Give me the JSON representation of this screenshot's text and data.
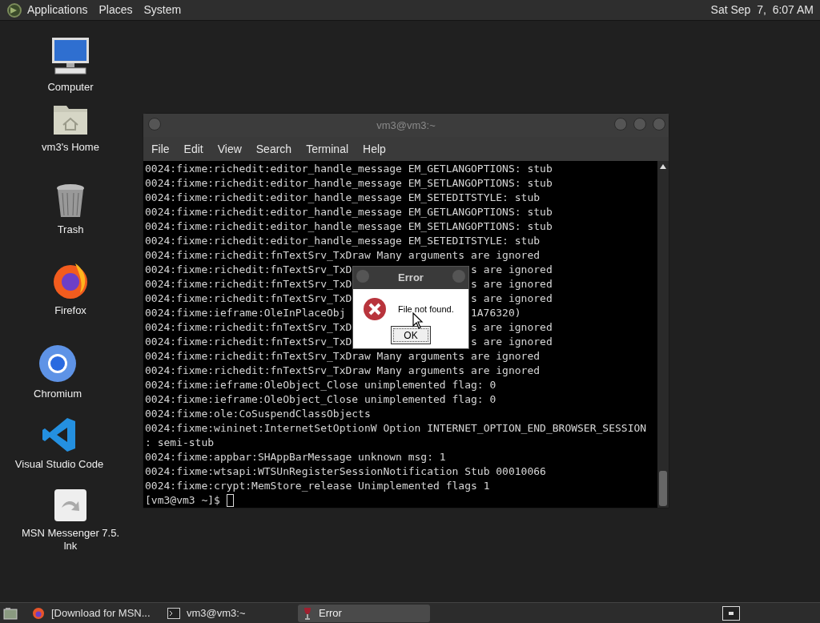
{
  "top_panel": {
    "menus": [
      "Applications",
      "Places",
      "System"
    ],
    "clock": "Sat Sep  7,  6:07 AM"
  },
  "desktop_icons": [
    {
      "kind": "computer",
      "label": "Computer"
    },
    {
      "kind": "home",
      "label": "vm3's Home"
    },
    {
      "kind": "trash",
      "label": "Trash"
    },
    {
      "kind": "firefox",
      "label": "Firefox"
    },
    {
      "kind": "chromium",
      "label": "Chromium"
    },
    {
      "kind": "vscode",
      "label": "Visual Studio Code"
    },
    {
      "kind": "shortcut",
      "label": "MSN Messenger 7.5.\nlnk"
    }
  ],
  "terminal": {
    "title": "vm3@vm3:~",
    "menu": [
      "File",
      "Edit",
      "View",
      "Search",
      "Terminal",
      "Help"
    ],
    "lines": [
      {
        "text": "0024:fixme:richedit:editor_handle_message EM_GETLANGOPTIONS: stub"
      },
      {
        "text": "0024:fixme:richedit:editor_handle_message EM_SETLANGOPTIONS: stub"
      },
      {
        "text": "0024:fixme:richedit:editor_handle_message EM_SETEDITSTYLE: stub"
      },
      {
        "text": "0024:fixme:richedit:editor_handle_message EM_GETLANGOPTIONS: stub"
      },
      {
        "text": "0024:fixme:richedit:editor_handle_message EM_SETLANGOPTIONS: stub"
      },
      {
        "text": "0024:fixme:richedit:editor_handle_message EM_SETEDITSTYLE: stub"
      },
      {
        "text": "0024:fixme:richedit:fnTextSrv_TxDraw Many arguments are ignored"
      },
      {
        "left": "0024:fixme:richedit:fnTextSrv_TxD",
        "right": "s are ignored"
      },
      {
        "left": "0024:fixme:richedit:fnTextSrv_TxD",
        "right": "s are ignored"
      },
      {
        "left": "0024:fixme:richedit:fnTextSrv_TxD",
        "right": "s are ignored"
      },
      {
        "left": "0024:fixme:ieframe:OleInPlaceObj",
        "right": "1A76320)"
      },
      {
        "left": "0024:fixme:richedit:fnTextSrv_TxD",
        "right": "s are ignored"
      },
      {
        "left": "0024:fixme:richedit:fnTextSrv_TxD",
        "right": "s are ignored"
      },
      {
        "text": "0024:fixme:richedit:fnTextSrv_TxDraw Many arguments are ignored"
      },
      {
        "text": "0024:fixme:richedit:fnTextSrv_TxDraw Many arguments are ignored"
      },
      {
        "text": "0024:fixme:ieframe:OleObject_Close unimplemented flag: 0"
      },
      {
        "text": "0024:fixme:ieframe:OleObject_Close unimplemented flag: 0"
      },
      {
        "text": "0024:fixme:ole:CoSuspendClassObjects"
      },
      {
        "text": "0024:fixme:wininet:InternetSetOptionW Option INTERNET_OPTION_END_BROWSER_SESSION"
      },
      {
        "text": ": semi-stub"
      },
      {
        "text": "0024:fixme:appbar:SHAppBarMessage unknown msg: 1"
      },
      {
        "text": "0024:fixme:wtsapi:WTSUnRegisterSessionNotification Stub 00010066"
      },
      {
        "text": "0024:fixme:crypt:MemStore_release Unimplemented flags 1"
      }
    ],
    "prompt": "[vm3@vm3 ~]$ "
  },
  "dialog": {
    "title": "Error",
    "message": "File not found.",
    "button": "OK"
  },
  "taskbar": {
    "items": [
      {
        "kind": "firefox",
        "label": "[Download for MSN...",
        "selected": false
      },
      {
        "kind": "terminal",
        "label": "vm3@vm3:~",
        "selected": false
      },
      {
        "kind": "wine",
        "label": "Error",
        "selected": true
      }
    ]
  }
}
